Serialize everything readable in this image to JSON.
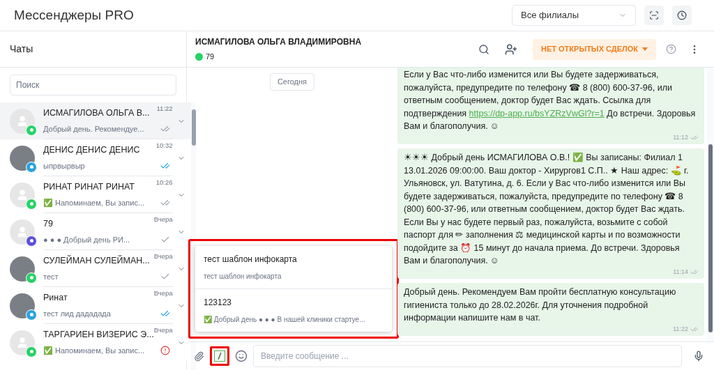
{
  "app_title": "Мессенджеры PRO",
  "branch_select": {
    "value": "Все филиалы"
  },
  "sidebar": {
    "title": "Чаты",
    "search": {
      "placeholder": "Поиск"
    },
    "chats": [
      {
        "name": "ИСМАГИЛОВА ОЛЬГА В...",
        "time": "11:22",
        "preview": "Добрый день. Рекомендуе...",
        "color": "#25d366",
        "photo": false,
        "kind": "read",
        "selected": true
      },
      {
        "name": "ДЕНИС ДЕНИС ДЕНИС",
        "time": "10:32",
        "preview": "ыпрвырвыр",
        "color": "#2aa3e0",
        "photo": true,
        "kind": "read_blue",
        "selected": false
      },
      {
        "name": "РИНАТ РИНАТ РИНАТ",
        "time": "10:26",
        "preview": "✅ Напоминаем, Вы запис...",
        "color": "#25d366",
        "photo": false,
        "kind": "read",
        "selected": false
      },
      {
        "name": "79",
        "time": "Вчера",
        "preview": "● ● ● Добрый день РИ...",
        "color": "#5b4fe0",
        "photo": false,
        "kind": "sent",
        "selected": false
      },
      {
        "name": "СУЛЕЙМАН СУЛЕЙМАН...",
        "time": "Вчера",
        "preview": "тест",
        "color": "#25d366",
        "photo": true,
        "kind": "sent",
        "selected": false
      },
      {
        "name": "Ринат",
        "time": "Вчера",
        "preview": "тест лид дададада",
        "color": "#2aa3e0",
        "photo": true,
        "kind": "read_blue",
        "selected": false
      },
      {
        "name": "ТАРГАРИЕН ВИЗЕРИС Э...",
        "time": "Вчера",
        "preview": "✅ Напоминаем, Вы запис...",
        "color": "#25d366",
        "photo": false,
        "kind": "error",
        "selected": false
      }
    ]
  },
  "chat": {
    "contact_name": "ИСМАГИЛОВА ОЛЬГА ВЛАДИМИРОВНА",
    "contact_phone": "79",
    "deals_button": "НЕТ ОТКРЫТЫХ СДЕЛОК",
    "date_chip": "Сегодня",
    "messages": [
      {
        "parts": [
          {
            "kind": "text",
            "text": "Если у Вас что-либо изменится или Вы будете задерживаться, пожалуйста, предупредите по телефону ☎ 8 (800) 600-37-96, или ответным сообщением, доктор будет Вас ждать. Ссылка для подтверждения "
          },
          {
            "kind": "link",
            "text": "https://dp-app.ru/bsYZRzVwGl?r=1"
          },
          {
            "kind": "text",
            "text": " До встречи. Здоровья Вам и благополучия. ☺"
          }
        ],
        "time": "11:12"
      },
      {
        "parts": [
          {
            "kind": "text",
            "text": "☀☀☀ Добрый день ИСМАГИЛОВА О.В.! ✅ Вы записаны: Филиал 1 13.01.2026 09:00:00. Ваш доктор - Хирургов1 С.П.. ★ Наш адрес: ⛳ г. Ульяновск, ул. Ватутина, д. 6. Если у Вас что-либо изменится или Вы будете задерживаться, пожалуйста, предупредите по телефону ☎ 8 (800) 600-37-96, или ответным сообщением, доктор будет Вас ждать. Если Вы у нас будете первый раз, пожалуйста, возьмите с собой паспорт для ✏ заполнения ⚖ медицинской карты и по возможности подойдите за ⏰ 15 минут до начала приема. До встречи. Здоровья Вам и благополучия. ☺"
          }
        ],
        "time": "11:14"
      },
      {
        "parts": [
          {
            "kind": "text",
            "text": "Добрый день. Рекомендуем Вам пройти бесплатную консультацию гигиениста только до 28.02.2026г. Для уточнения подробной информации напишите нам в чат."
          }
        ],
        "time": "11:22"
      }
    ],
    "templates": [
      {
        "title": "тест шаблон инфокарта",
        "text": "тест шаблон инфокарта"
      },
      {
        "title": "123123",
        "text": "✅ Добрый день ● ● ● В нашей клиники стартуе..."
      }
    ],
    "message_input": {
      "placeholder": "Введите сообщение ..."
    }
  }
}
